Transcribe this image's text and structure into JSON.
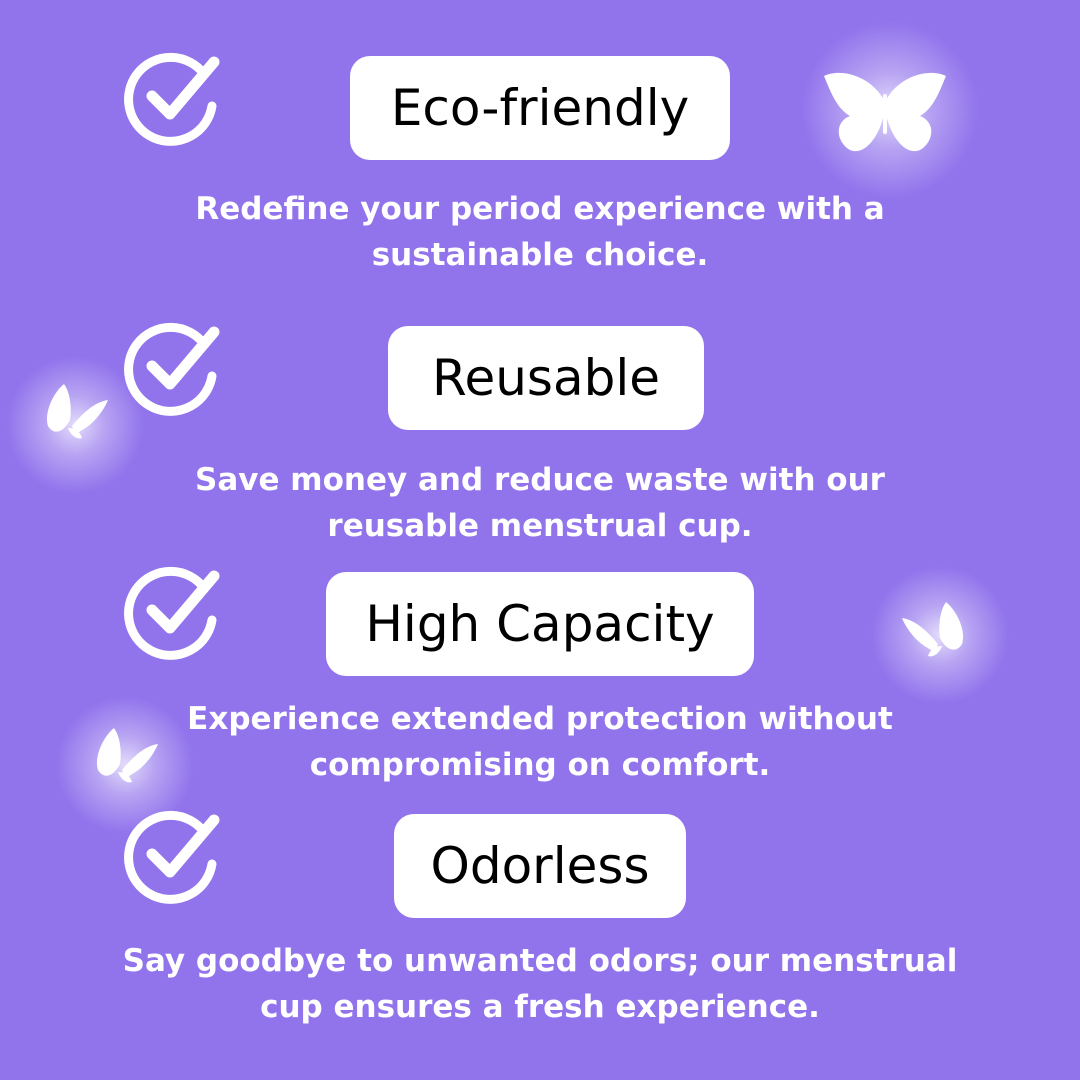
{
  "features": [
    {
      "title": "Eco-friendly",
      "description_line1": "Redefine your period experience with a",
      "description_line2": "sustainable choice."
    },
    {
      "title": "Reusable",
      "description_line1": "Save money and reduce waste with our",
      "description_line2": "reusable menstrual cup."
    },
    {
      "title": "High Capacity",
      "description_line1": "Experience extended protection without",
      "description_line2": "compromising on comfort."
    },
    {
      "title": "Odorless",
      "description_line1": "Say goodbye to unwanted odors; our menstrual",
      "description_line2": "cup ensures a fresh experience."
    }
  ],
  "colors": {
    "background": "#9173EC",
    "pill_background": "#FFFFFF",
    "title_text": "#000000",
    "description_text": "#FFFFFF",
    "icon": "#FFFFFF"
  },
  "icons": {
    "check": "check-circle-icon",
    "decoration": "butterfly-icon"
  }
}
